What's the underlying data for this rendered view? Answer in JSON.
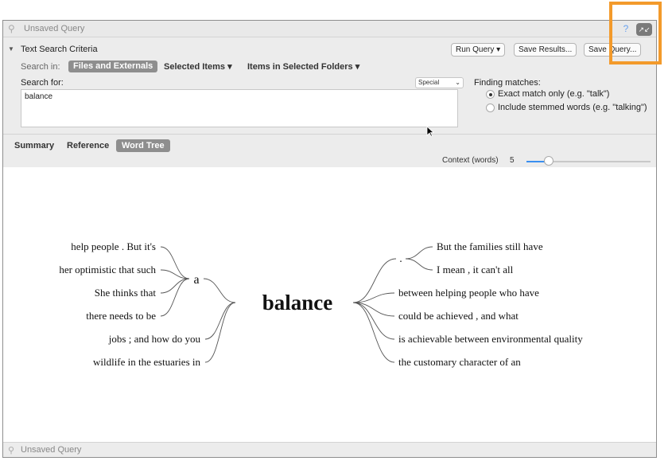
{
  "window": {
    "title": "Unsaved Query",
    "footer_title": "Unsaved Query",
    "accent": "#f39a2b"
  },
  "criteria": {
    "title": "Text Search Criteria",
    "run_query": "Run Query",
    "save_results": "Save Results...",
    "save_query": "Save Query...",
    "search_in_label": "Search in:",
    "scopes": [
      "Files and Externals",
      "Selected Items",
      "Items in Selected Folders"
    ],
    "search_for_label": "Search for:",
    "special_label": "Special",
    "query_text": "balance",
    "finding_label": "Finding matches:",
    "exact_label": "Exact match only (e.g. \"talk\")",
    "stemmed_label": "Include stemmed words (e.g. \"talking\")"
  },
  "tabs": {
    "summary": "Summary",
    "reference": "Reference",
    "word_tree": "Word Tree"
  },
  "context": {
    "label": "Context (words)",
    "value": "5",
    "level": 0.22
  },
  "word_tree": {
    "keyword": "balance",
    "left_join": "a",
    "left_to_a": [
      "help people . But it's",
      "her optimistic that such",
      "She thinks that",
      "there needs to be"
    ],
    "left_direct": [
      "jobs ; and how do you",
      "wildlife in the estuaries in"
    ],
    "right_period": ".",
    "right_after_period": [
      "But the families still have",
      "I mean , it can't all"
    ],
    "right_direct": [
      "between helping people who have",
      "could be achieved , and what",
      "is achievable between environmental quality",
      "the customary character of an"
    ]
  }
}
